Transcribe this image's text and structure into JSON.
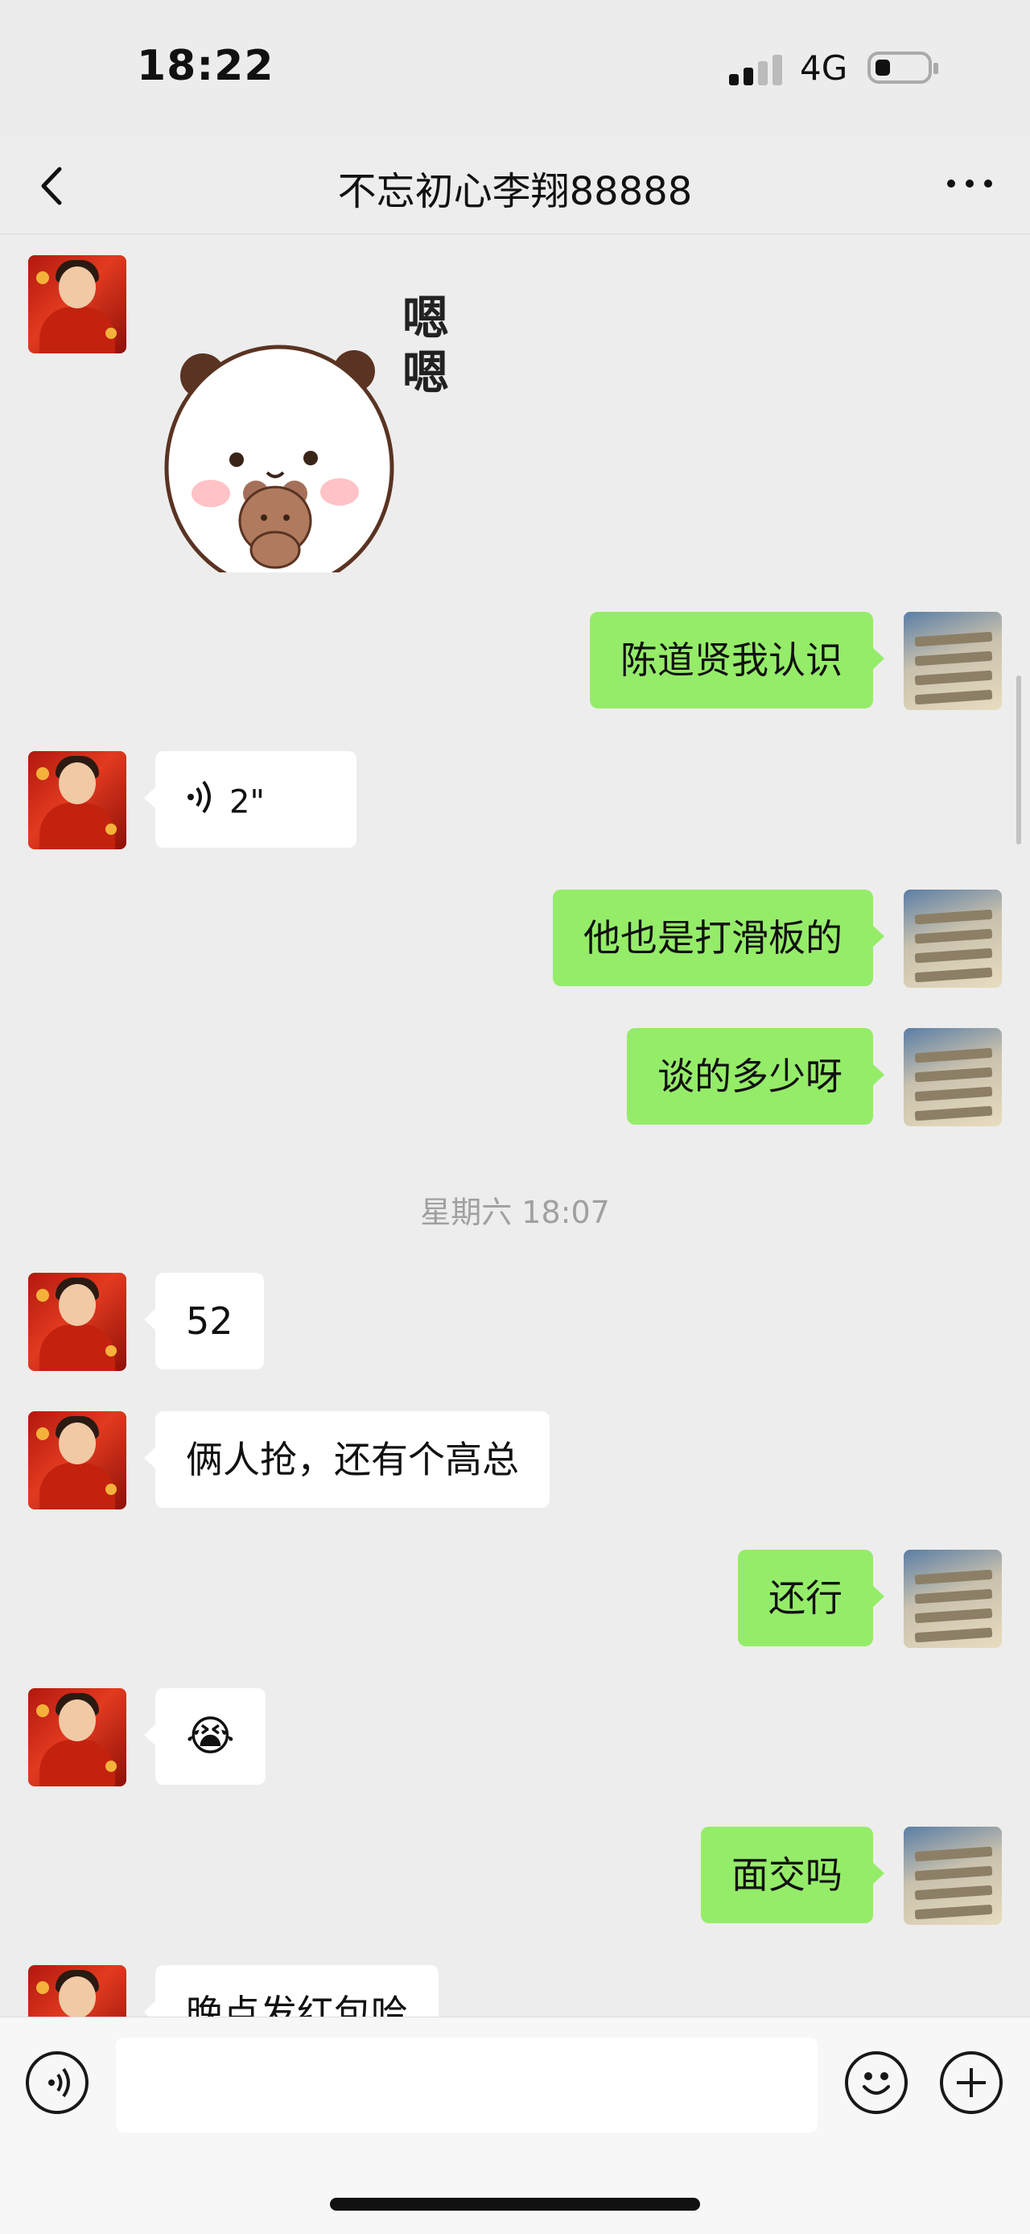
{
  "status_bar": {
    "time": "18:22",
    "network": "4G",
    "icons": [
      "signal-icon",
      "battery-icon"
    ]
  },
  "nav": {
    "title": "不忘初心李翔88888",
    "back_icon": "chevron-left-icon",
    "more_icon": "more-icon"
  },
  "messages": [
    {
      "from": "them",
      "type": "sticker",
      "text": "嗯嗯"
    },
    {
      "from": "me",
      "type": "text",
      "text": "陈道贤我认识"
    },
    {
      "from": "them",
      "type": "voice",
      "duration": "2\""
    },
    {
      "from": "me",
      "type": "text",
      "text": "他也是打滑板的"
    },
    {
      "from": "me",
      "type": "text",
      "text": "谈的多少呀"
    },
    {
      "type": "timestamp",
      "text": "星期六 18:07"
    },
    {
      "from": "them",
      "type": "text",
      "text": "52"
    },
    {
      "from": "them",
      "type": "text",
      "text": "俩人抢，还有个高总"
    },
    {
      "from": "me",
      "type": "text",
      "text": "还行"
    },
    {
      "from": "them",
      "type": "emoji",
      "text": "😭"
    },
    {
      "from": "me",
      "type": "text",
      "text": "面交吗"
    },
    {
      "from": "them",
      "type": "text",
      "text": "晚点发红包哈"
    }
  ],
  "input_bar": {
    "input_value": "",
    "voice_icon": "voice-icon",
    "emoji_icon": "emoji-icon",
    "add_icon": "plus-icon"
  },
  "colors": {
    "background": "#ededed",
    "my_bubble": "#95ec69",
    "their_bubble": "#ffffff"
  }
}
